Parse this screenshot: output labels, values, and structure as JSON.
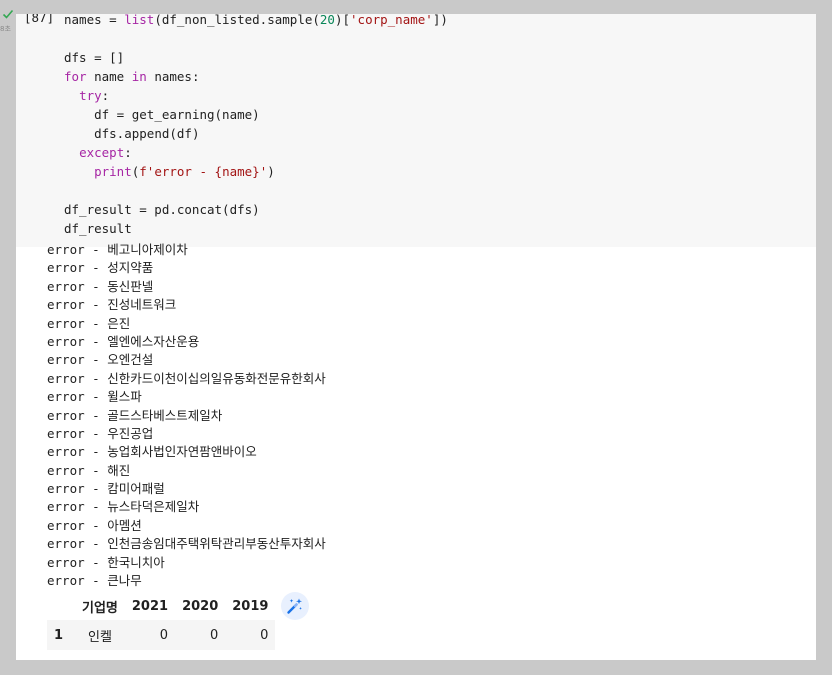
{
  "cell": {
    "status_icon": "check-icon",
    "exec_time": "8초",
    "exec_count": "[87]"
  },
  "code": {
    "line1": {
      "a": "names = ",
      "b": "list",
      "c": "(df_non_listed.sample(",
      "d": "20",
      "e": ")[",
      "f": "'corp_name'",
      "g": "])"
    },
    "line3": "dfs = []",
    "line4": {
      "kw1": "for",
      "a": " name ",
      "kw2": "in",
      "b": " names:"
    },
    "line5": {
      "kw": "try",
      "a": ":"
    },
    "line6": "df = get_earning(name)",
    "line7": "dfs.append(df)",
    "line8": {
      "kw": "except",
      "a": ":"
    },
    "line9": {
      "fn": "print",
      "a": "(",
      "s": "f'error - {name}'",
      "b": ")"
    },
    "line11": "df_result = pd.concat(dfs)",
    "line12": "df_result"
  },
  "output_lines": [
    "error - 베고니아제이차",
    "error - 성지약품",
    "error - 동신판넬",
    "error - 진성네트워크",
    "error - 은진",
    "error - 엘엔에스자산운용",
    "error - 오엔건설",
    "error - 신한카드이천이십의일유동화전문유한회사",
    "error - 윌스파",
    "error - 골드스타베스트제일차",
    "error - 우진공업",
    "error - 농업회사법인자연팜앤바이오",
    "error - 해진",
    "error - 캄미어패럴",
    "error - 뉴스타덕은제일차",
    "error - 아멤션",
    "error - 인천금송임대주택위탁관리부동산투자회사",
    "error - 한국니치아",
    "error - 큰나무"
  ],
  "dataframe": {
    "columns": [
      "",
      "기업명",
      "2021",
      "2020",
      "2019"
    ],
    "rows": [
      {
        "index": "1",
        "name": "인켈",
        "v2021": "0",
        "v2020": "0",
        "v2019": "0"
      }
    ]
  },
  "toolbar": {
    "wand_icon": "magic-wand-icon"
  }
}
